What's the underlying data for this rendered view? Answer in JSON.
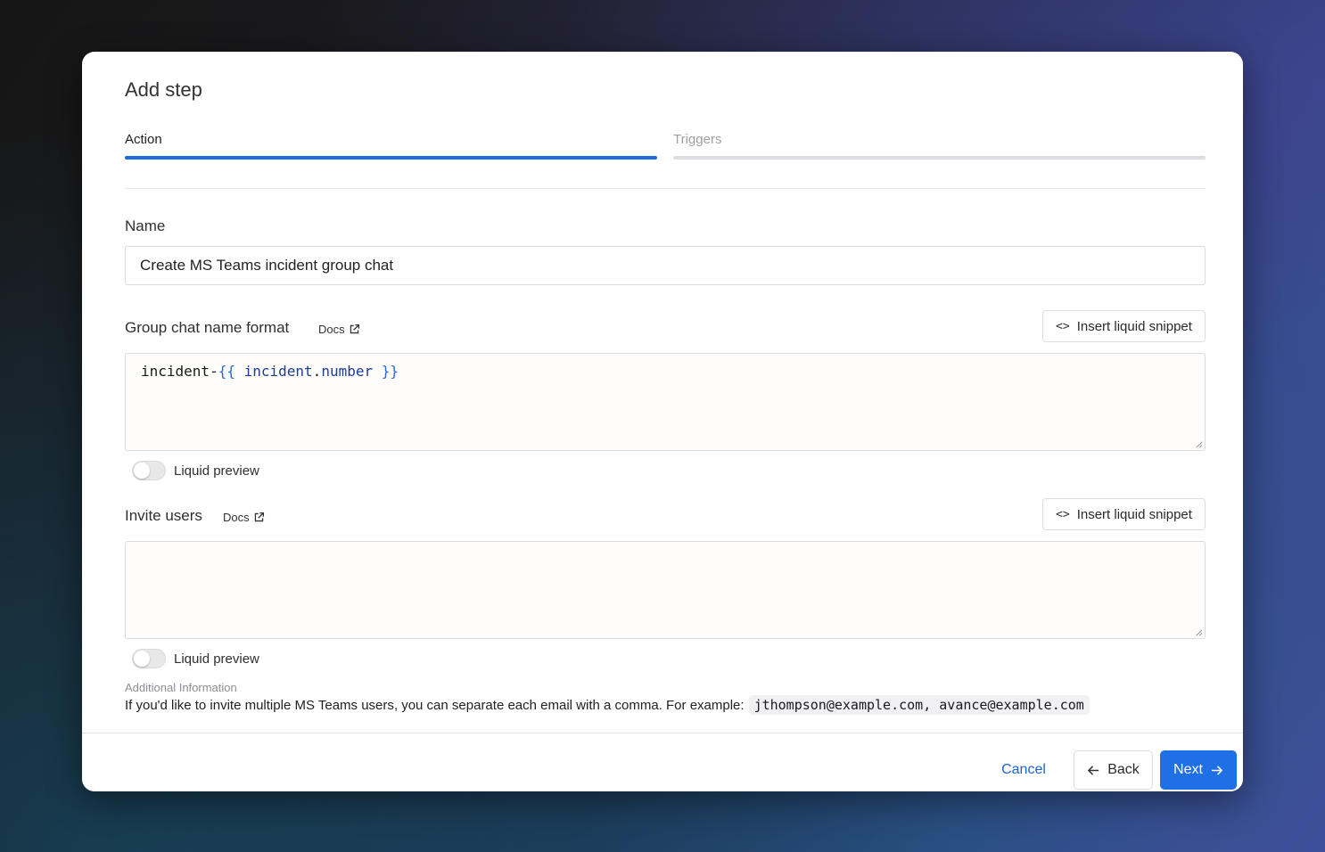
{
  "dialog": {
    "title": "Add step",
    "tabs": [
      {
        "label": "Action",
        "active": true
      },
      {
        "label": "Triggers",
        "active": false
      }
    ]
  },
  "name_field": {
    "label": "Name",
    "value": "Create MS Teams incident group chat"
  },
  "group_chat": {
    "label": "Group chat name format",
    "docs_label": "Docs",
    "snippet_button": "Insert liquid snippet",
    "code_prefix": "incident-",
    "code_open": "{{",
    "code_var_object": "incident",
    "code_var_dot": ".",
    "code_var_field": "number",
    "code_close": "}}",
    "preview_label": "Liquid preview"
  },
  "invite_users": {
    "label": "Invite users",
    "docs_label": "Docs",
    "snippet_button": "Insert liquid snippet",
    "value": "",
    "preview_label": "Liquid preview"
  },
  "additional_info": {
    "heading": "Additional Information",
    "text": "If you'd like to invite multiple MS Teams users, you can separate each email with a comma. For example:",
    "example": "jthompson@example.com, avance@example.com"
  },
  "footer": {
    "cancel_label": "Cancel",
    "back_label": "Back",
    "next_label": "Next"
  },
  "colors": {
    "accent": "#1f6fe6",
    "tab_inactive": "#dddde2"
  }
}
